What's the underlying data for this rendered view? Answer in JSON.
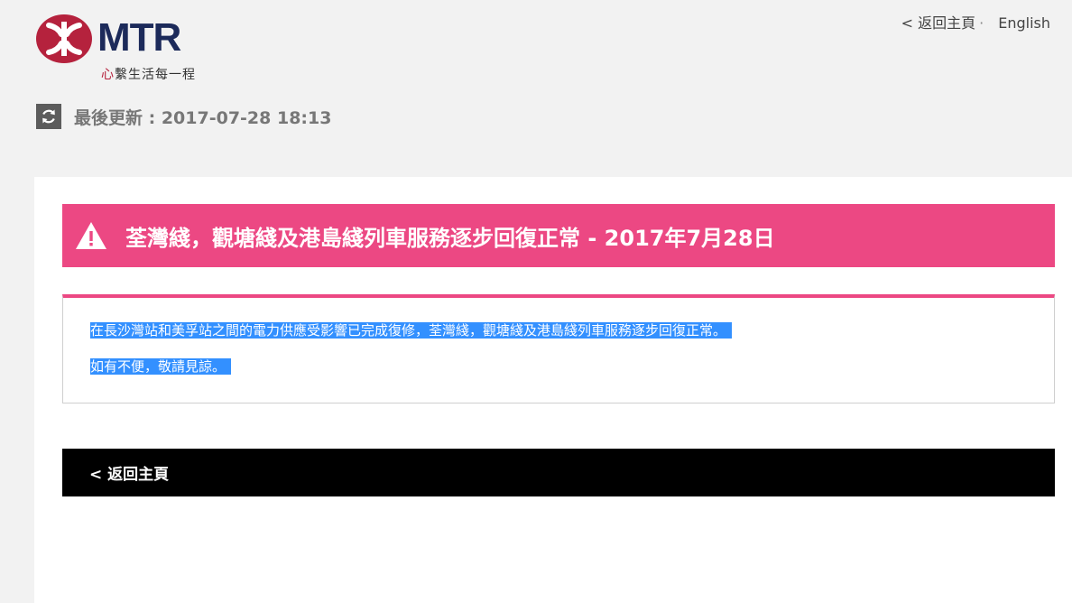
{
  "header": {
    "brand": "MTR",
    "tagline_heart": "心",
    "tagline_rest": "繫生活每一程",
    "nav": {
      "home_link": "< 返回主頁",
      "separator": "·",
      "language_link": "English"
    },
    "last_updated": "最後更新 : 2017-07-28 18:13"
  },
  "alert": {
    "title": "荃灣綫，觀塘綫及港島綫列車服務逐步回復正常 - 2017年7月28日",
    "messages": [
      "在長沙灣站和美孚站之間的電力供應受影響已完成復修，荃灣綫，觀塘綫及港島綫列車服務逐步回復正常。",
      "如有不便，敬請見諒。"
    ]
  },
  "footer": {
    "back_link": "< 返回主頁"
  },
  "colors": {
    "brand_red": "#b5223d",
    "brand_navy": "#1c2a5a",
    "alert_pink": "#ec4883",
    "selection_blue": "#3390ff"
  },
  "icons": {
    "logo": "mtr-logo-icon",
    "refresh": "refresh-icon",
    "warning": "warning-triangle-icon"
  }
}
